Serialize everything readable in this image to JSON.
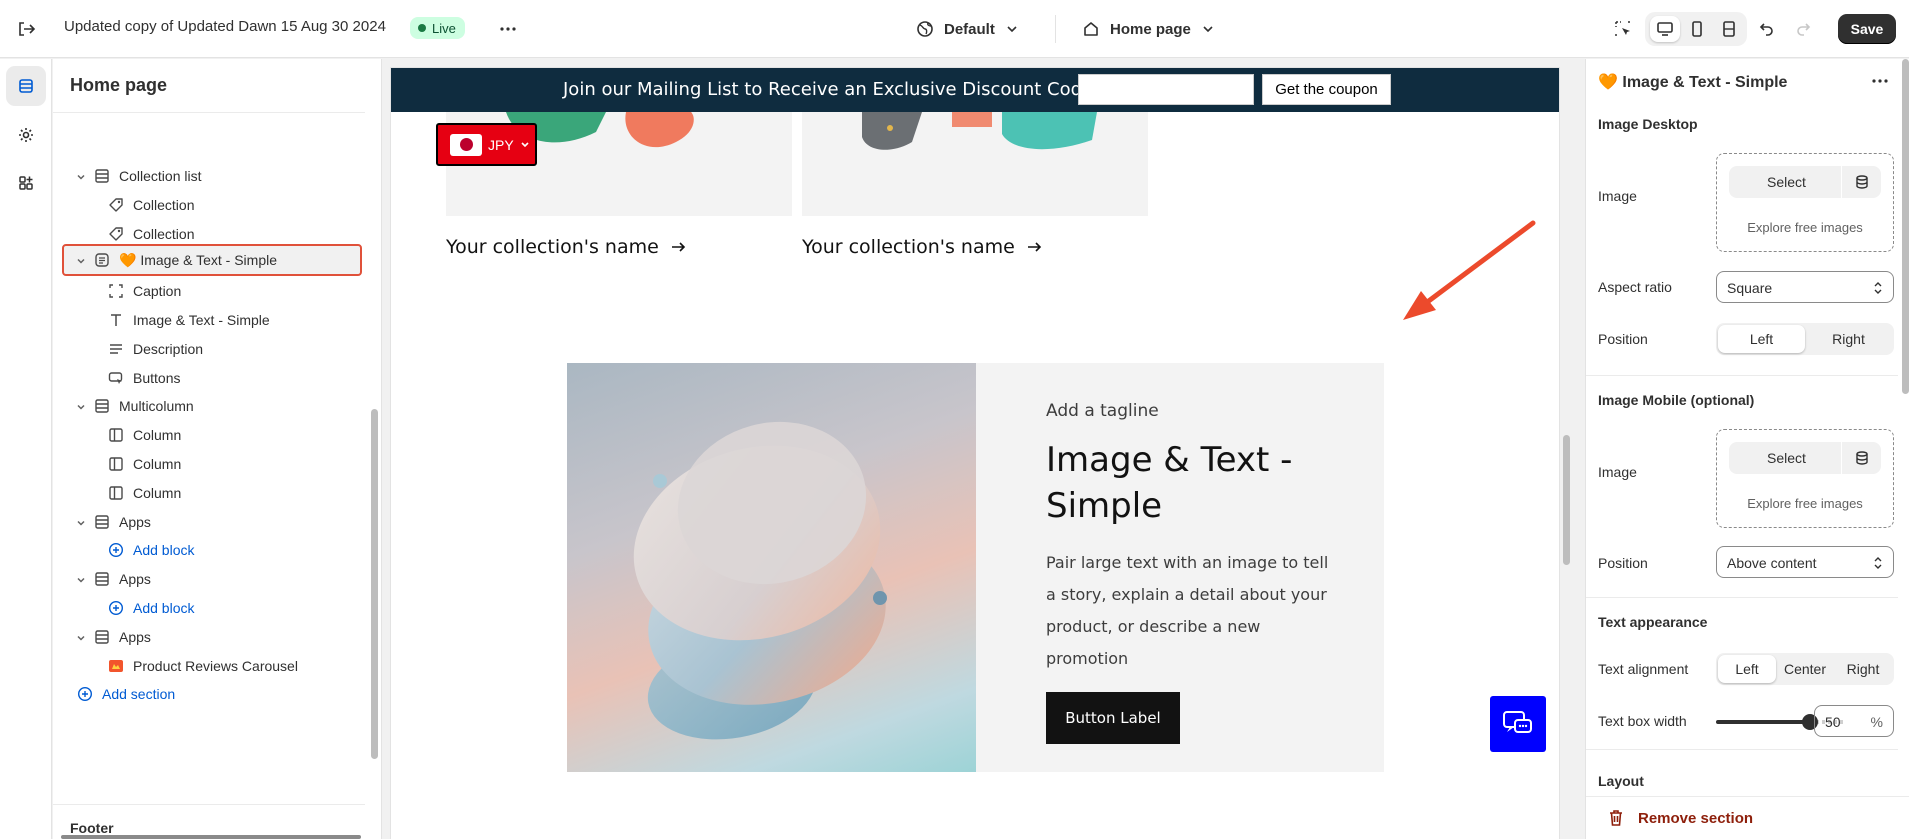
{
  "topbar": {
    "store_title": "Updated copy of Updated Dawn 15 Aug 30 2024",
    "live_badge": "Live",
    "theme_selector": "Default",
    "page_selector": "Home page",
    "save_label": "Save"
  },
  "sidebar": {
    "title": "Home page",
    "footer_label": "Footer",
    "rows": [
      {
        "label": "Collection list",
        "level": 0,
        "icon": "section-icon"
      },
      {
        "label": "Collection",
        "level": 1,
        "icon": "tag-icon"
      },
      {
        "label": "Collection",
        "level": 1,
        "icon": "tag-icon"
      },
      {
        "label": "🧡 Image & Text - Simple",
        "level": 0,
        "icon": "section-list-icon"
      },
      {
        "label": "Caption",
        "level": 1,
        "icon": "caption-icon"
      },
      {
        "label": "Image & Text - Simple",
        "level": 1,
        "icon": "text-icon"
      },
      {
        "label": "Description",
        "level": 1,
        "icon": "paragraph-icon"
      },
      {
        "label": "Buttons",
        "level": 1,
        "icon": "button-icon"
      },
      {
        "label": "Multicolumn",
        "level": 0,
        "icon": "section-icon"
      },
      {
        "label": "Column",
        "level": 1,
        "icon": "column-icon"
      },
      {
        "label": "Column",
        "level": 1,
        "icon": "column-icon"
      },
      {
        "label": "Column",
        "level": 1,
        "icon": "column-icon"
      },
      {
        "label": "Apps",
        "level": 0,
        "icon": "section-icon"
      },
      {
        "label": "Add block",
        "level": 1,
        "icon": "plus-circle-icon"
      },
      {
        "label": "Apps",
        "level": 0,
        "icon": "section-icon"
      },
      {
        "label": "Add block",
        "level": 1,
        "icon": "plus-circle-icon"
      },
      {
        "label": "Apps",
        "level": 0,
        "icon": "section-icon"
      },
      {
        "label": "Product Reviews Carousel",
        "level": 1,
        "icon": "app-icon"
      },
      {
        "label": "Add section",
        "level": 0,
        "icon": "plus-circle-icon"
      }
    ]
  },
  "preview": {
    "promo_text": "Join our Mailing List to Receive an Exclusive Discount Code!",
    "promo_button": "Get the coupon",
    "currency": "JPY",
    "collection_names": [
      "Your collection's name",
      "Your collection's name"
    ],
    "tagline": "Add a tagline",
    "heading": "Image & Text - Simple",
    "description": "Pair large text with an image to tell a story, explain a detail about your product, or describe a new promotion",
    "button_label": "Button Label"
  },
  "settings": {
    "title": "🧡 Image & Text - Simple",
    "image_desktop_heading": "Image Desktop",
    "image_label": "Image",
    "select_label": "Select",
    "explore_label": "Explore free images",
    "aspect_ratio_label": "Aspect ratio",
    "aspect_ratio_value": "Square",
    "position_label": "Position",
    "position_options": [
      "Left",
      "Right"
    ],
    "position_selected": "Left",
    "image_mobile_heading": "Image Mobile (optional)",
    "mobile_position_value": "Above content",
    "text_appearance_heading": "Text appearance",
    "text_alignment_label": "Text alignment",
    "text_alignment_options": [
      "Left",
      "Center",
      "Right"
    ],
    "text_alignment_selected": "Left",
    "text_box_width_label": "Text box width",
    "text_box_width_value": "50",
    "text_box_width_unit": "%",
    "layout_heading": "Layout",
    "remove_section_label": "Remove section"
  },
  "colors": {
    "accent_selection": "#e0513a",
    "promo_bar": "#0f2c3f",
    "chat_button": "#0000ff",
    "remove_red": "#8e1f0b",
    "link_blue": "#005bd3"
  }
}
